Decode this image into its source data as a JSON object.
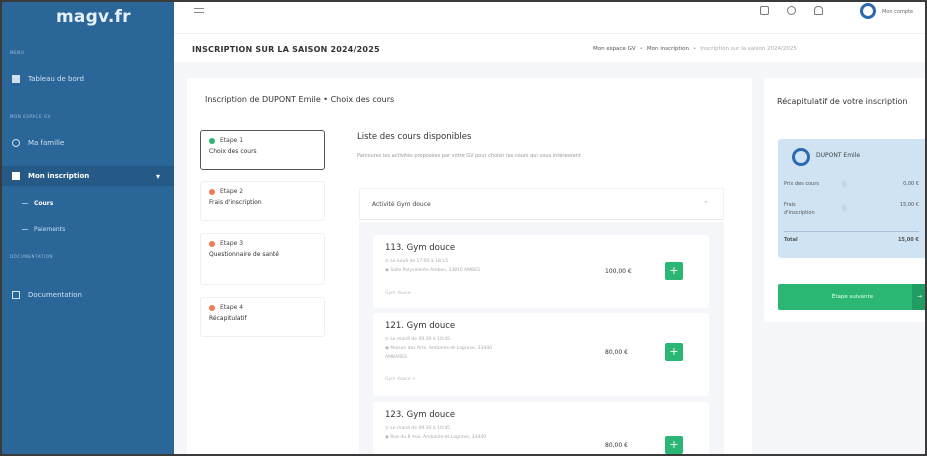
{
  "app": {
    "logo": "magv.fr"
  },
  "sidebar": {
    "section1": "MENU",
    "dashboard": "Tableau de bord",
    "section2": "MON ESPACE GV",
    "family": "Ma famille",
    "inscription": "Mon inscription",
    "courses": "Cours",
    "payments": "Paiements",
    "section3": "DOCUMENTATION",
    "documentation": "Documentation"
  },
  "topbar": {
    "user": "Mon compte"
  },
  "page": {
    "title": "INSCRIPTION SUR LA SAISON 2024/2025",
    "breadcrumb": [
      "Mon espace GV",
      "Mon inscription",
      "Inscription sur la saison 2024/2025"
    ]
  },
  "card": {
    "title": "Inscription de DUPONT Emile • Choix des cours"
  },
  "steps": [
    {
      "label": "Etape 1",
      "desc": "Choix des cours",
      "status": "green"
    },
    {
      "label": "Etape 2",
      "desc": "Frais d'inscription",
      "status": "orange"
    },
    {
      "label": "Etape 3",
      "desc": "Questionnaire de santé",
      "status": "orange"
    },
    {
      "label": "Etape 4",
      "desc": "Récapitulatif",
      "status": "orange"
    }
  ],
  "list": {
    "title": "Liste des cours disponibles",
    "desc": "Parcourez les activités proposées par votre GV pour choisir les cours qui vous intéressent",
    "activity": "Activité Gym douce"
  },
  "courses": [
    {
      "title": "113. Gym douce",
      "schedule": "Le lundi de 17:00 à 18:15",
      "place": "Salle Polyvalente Ambes, 33810 AMBES",
      "tag": "Gym douce",
      "price": "100,00 €"
    },
    {
      "title": "121. Gym douce",
      "schedule": "Le mardi de 09:30 à 10:45",
      "place": "Maison des Arts, Ambarès-et-Lagrave, 33440",
      "place2": "AMBARES",
      "tag": "Gym douce +",
      "price": "80,00 €"
    },
    {
      "title": "123. Gym douce",
      "schedule": "Le mardi de 09:30 à 10:45",
      "place": "Rue du 8 mai, Ambarès-et-Lagrave, 33440",
      "price": "80,00 €"
    }
  ],
  "summary": {
    "title": "Récapitulatif de votre inscription",
    "name": "DUPONT Emile",
    "course_price_label": "Prix des cours",
    "course_price": "0,00 €",
    "fees_label_1": "Frais",
    "fees_label_2": "d'inscription",
    "fees": "15,00 €",
    "total_label": "Total",
    "total": "15,00 €",
    "next": "Étape suivante"
  }
}
